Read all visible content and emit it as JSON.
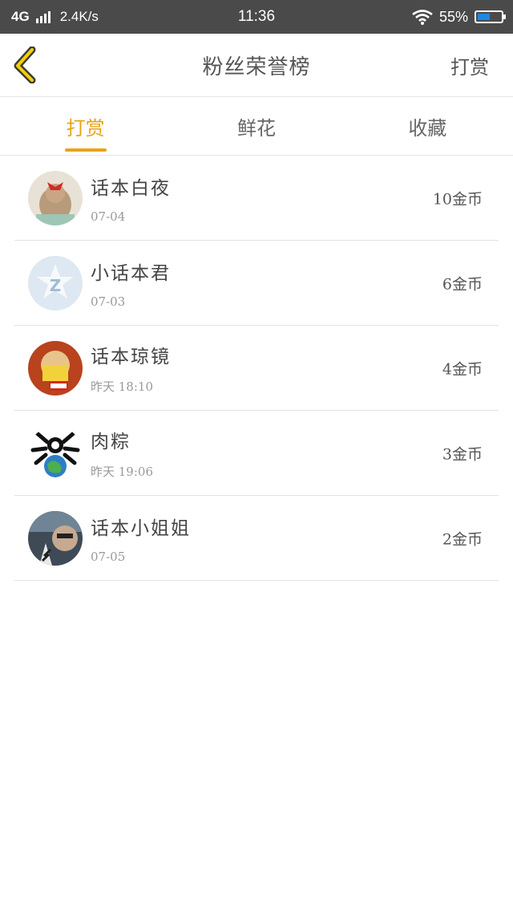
{
  "status_bar": {
    "network": "4G",
    "speed": "2.4K/s",
    "time": "11:36",
    "battery": "55%",
    "battery_level": 0.55
  },
  "header": {
    "back_icon": "chevron-left-icon",
    "title": "粉丝荣誉榜",
    "action_label": "打赏"
  },
  "tabs": [
    {
      "label": "打赏",
      "active": true
    },
    {
      "label": "鲜花",
      "active": false
    },
    {
      "label": "收藏",
      "active": false
    }
  ],
  "colors": {
    "accent": "#e8a317",
    "status_bar_bg": "#4a4a4a"
  },
  "rows": [
    {
      "name": "话本白夜",
      "time": "07-04",
      "coins": "10金币"
    },
    {
      "name": "小话本君",
      "time": "07-03",
      "coins": "6金币"
    },
    {
      "name": "话本琼镜",
      "time": "昨天 18:10",
      "coins": "4金币"
    },
    {
      "name": "肉粽",
      "time": "昨天 19:06",
      "coins": "3金币"
    },
    {
      "name": "话本小姐姐",
      "time": "07-05",
      "coins": "2金币"
    }
  ]
}
